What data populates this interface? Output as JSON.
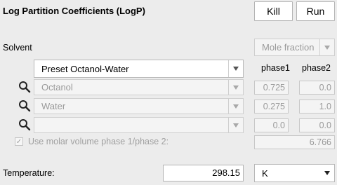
{
  "title": "Log Partition Coefficients (LogP)",
  "buttons": {
    "kill": "Kill",
    "run": "Run"
  },
  "solvent": {
    "label": "Solvent",
    "unit_select": "Mole fraction",
    "preset": "Preset Octanol-Water",
    "col_phase1": "phase1",
    "col_phase2": "phase2",
    "rows": [
      {
        "name": "Octanol",
        "phase1": "0.725",
        "phase2": "0.0"
      },
      {
        "name": "Water",
        "phase1": "0.275",
        "phase2": "1.0"
      },
      {
        "name": "",
        "phase1": "0.0",
        "phase2": "0.0"
      }
    ]
  },
  "molar_volume": {
    "label": "Use molar volume phase 1/phase 2:",
    "checked": true,
    "value": "6.766"
  },
  "temperature": {
    "label": "Temperature:",
    "value": "298.15",
    "unit": "K"
  },
  "icons": {
    "search": "magnifier-icon",
    "dropdown": "triangle-down-icon",
    "check": "checkmark-icon"
  }
}
